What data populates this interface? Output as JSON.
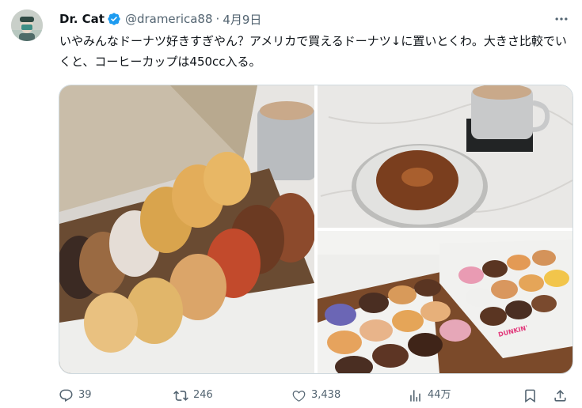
{
  "tweet": {
    "author_name": "Dr. Cat",
    "handle": "@dramerica88",
    "separator": "·",
    "date": "4月9日",
    "text": "いやみんなドーナツ好きすぎやん？アメリカで買えるドーナツ↓に置いとくわ。大きさ比較でいくと、コーヒーカップは450cc入る。"
  },
  "media": {
    "images": [
      {
        "name": "donut-box-photo"
      },
      {
        "name": "donut-plate-coffee-photo"
      },
      {
        "name": "dunkin-boxes-photo",
        "box_brand_text": "DUNKIN'"
      }
    ]
  },
  "actions": {
    "replies": "39",
    "reposts": "246",
    "likes": "3,438",
    "views": "44万"
  },
  "colors": {
    "text_primary": "#0f1419",
    "text_secondary": "#536471",
    "verified_blue": "#1d9bf0",
    "border": "#cfd9de"
  },
  "icons": [
    "more-icon",
    "verified-icon",
    "reply-icon",
    "repost-icon",
    "like-icon",
    "views-icon",
    "bookmark-icon",
    "share-icon"
  ]
}
